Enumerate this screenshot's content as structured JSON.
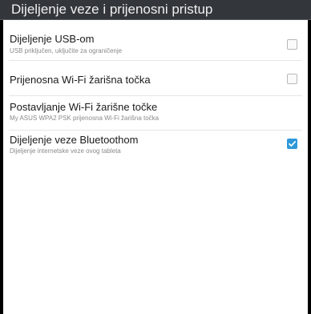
{
  "header": {
    "title": "Dijeljenje veze i prijenosni pristup"
  },
  "settings": {
    "usb": {
      "title": "Dijeljenje USB-om",
      "subtitle": "USB priključen, uključite za ograničenje",
      "checked": false
    },
    "hotspot": {
      "title": "Prijenosna Wi-Fi žarišna točka",
      "checked": false
    },
    "hotspot_setup": {
      "title": "Postavljanje Wi-Fi žarišne točke",
      "subtitle": "My ASUS WPA2 PSK prijenosna Wi-Fi žarišna točka"
    },
    "bluetooth": {
      "title": "Dijeljenje veze Bluetoothom",
      "subtitle": "Dijeljenje internetske veze ovog tableta",
      "checked": true
    }
  },
  "colors": {
    "header_background": "#33373c",
    "panel_background": "#ffffff",
    "checkbox_accent": "#2f98d9"
  }
}
